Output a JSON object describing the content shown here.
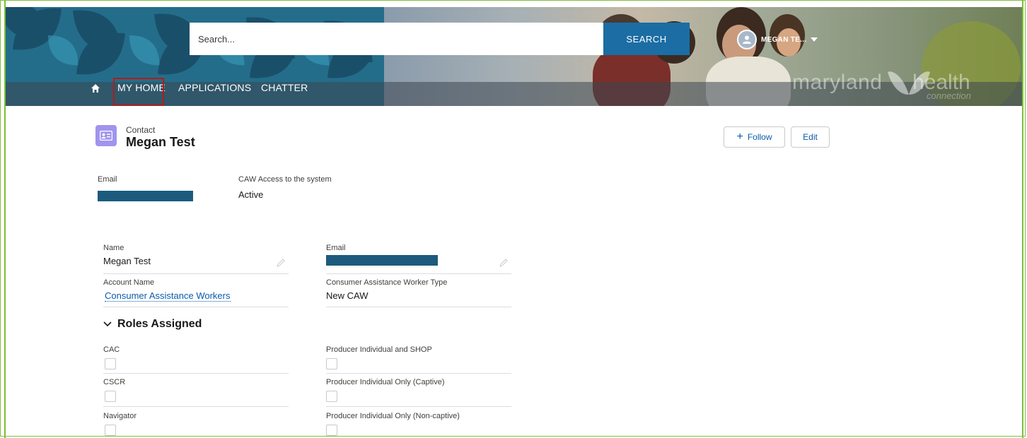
{
  "header": {
    "search": {
      "placeholder": "Search...",
      "button_label": "SEARCH"
    },
    "user_name": "MEGAN TE...",
    "brand_left": "maryland",
    "brand_right": "health",
    "brand_sub": "connection",
    "nav": [
      {
        "label": "MY HOME"
      },
      {
        "label": "APPLICATIONS"
      },
      {
        "label": "CHATTER"
      }
    ],
    "colors": {
      "pattern": "#246d8a",
      "search_button": "#1b6da3",
      "highlight_outline": "#b31b1b"
    }
  },
  "record": {
    "type": "Contact",
    "name": "Megan Test",
    "follow_label": "Follow",
    "edit_label": "Edit",
    "icon": "contact-card-icon"
  },
  "highlights": {
    "email_label": "Email",
    "caw_label": "CAW Access to the system",
    "caw_value": "Active"
  },
  "details": {
    "name_label": "Name",
    "name_value": "Megan Test",
    "email_label": "Email",
    "account_label": "Account Name",
    "account_value": "Consumer Assistance Workers",
    "type_label": "Consumer Assistance Worker Type",
    "type_value": "New CAW"
  },
  "roles": {
    "section_title": "Roles Assigned",
    "left": [
      {
        "label": "CAC"
      },
      {
        "label": "CSCR"
      },
      {
        "label": "Navigator"
      }
    ],
    "right": [
      {
        "label": "Producer Individual and SHOP"
      },
      {
        "label": "Producer Individual Only (Captive)"
      },
      {
        "label": "Producer Individual Only (Non-captive)"
      }
    ]
  }
}
